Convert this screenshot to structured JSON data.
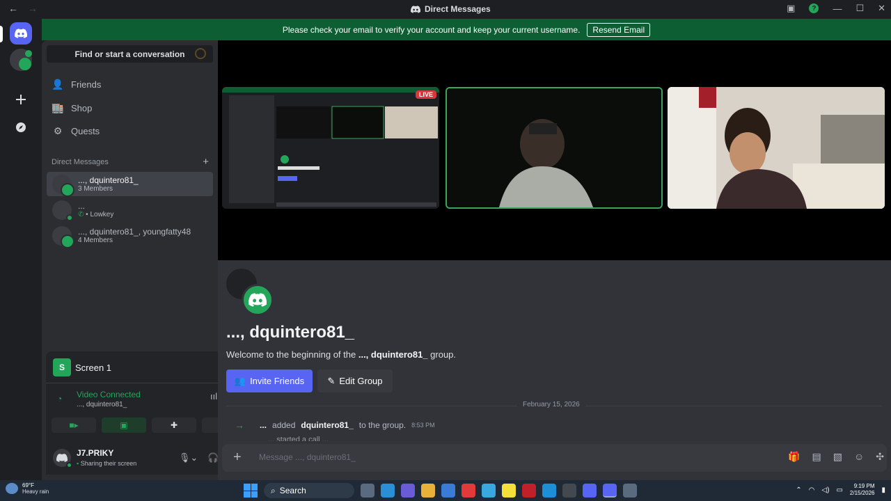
{
  "titlebar": {
    "back": "←",
    "forward": "→",
    "title": "Direct Messages"
  },
  "banner": {
    "text": "Please check your email to verify your account and keep your current username.",
    "button": "Resend Email"
  },
  "sidebar": {
    "search_label": "Find or start a conversation",
    "nav": [
      {
        "label": "Friends",
        "icon": "friends-icon"
      },
      {
        "label": "Shop",
        "icon": "shop-icon"
      },
      {
        "label": "Quests",
        "icon": "quests-icon"
      }
    ],
    "dm_header": "Direct Messages",
    "dms": [
      {
        "name": "..., dquintero81_",
        "sub": "3 Members",
        "active": true
      },
      {
        "name": "...",
        "sub": "• Lowkey",
        "active": false
      },
      {
        "name": "..., dquintero81_, youngfatty48",
        "sub": "4 Members",
        "active": false
      }
    ]
  },
  "voice": {
    "screen_label": "Screen 1",
    "screen_badge": "S",
    "status": "Video Connected",
    "channel": "..., dquintero81_"
  },
  "user": {
    "name": "J7.PRIKY",
    "status": "Sharing their screen"
  },
  "stage": {
    "live_badge": "LIVE"
  },
  "welcome": {
    "title": "..., dquintero81_",
    "text_prefix": "Welcome to the beginning of the",
    "text_group": "..., dquintero81_",
    "text_suffix": "group.",
    "invite_button": "Invite Friends",
    "edit_button": "Edit Group"
  },
  "messages": {
    "date": "February 15, 2026",
    "system_actor": "...",
    "system_action": "added",
    "system_target": "dquintero81_",
    "system_suffix": "to the group.",
    "system_time": "8:53 PM",
    "partial_text": "... started a call ..."
  },
  "composer": {
    "placeholder": "Message ..., dquintero81_"
  },
  "taskbar": {
    "temp": "69°F",
    "weather": "Heavy rain",
    "search": "Search",
    "time": "9:19 PM",
    "date": "2/15/2026"
  }
}
